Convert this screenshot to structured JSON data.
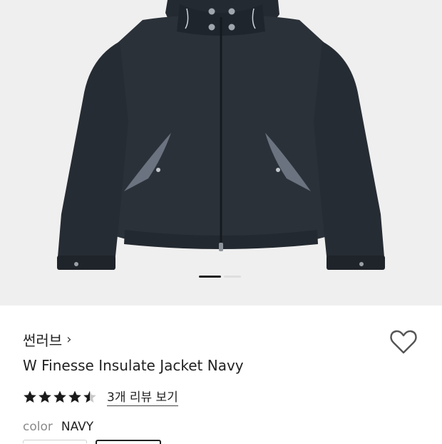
{
  "product": {
    "image_alt": "W Finesse Insulate Jacket Navy product photo",
    "brand": "썬러브",
    "brand_chevron": "›",
    "title": "W Finesse Insulate Jacket Navy",
    "rating": 4.5,
    "review_link": "3개 리뷰 보기",
    "color_label": "color",
    "color_value": "NAVY"
  },
  "carousel": {
    "current": 1,
    "total": 2
  },
  "colors": {
    "jacket": "#2a2f36",
    "lining": "#6b7380",
    "background": "#efefef",
    "text": "#222222"
  },
  "icons": {
    "wishlist": "heart-outline-icon",
    "star": "star-icon"
  }
}
